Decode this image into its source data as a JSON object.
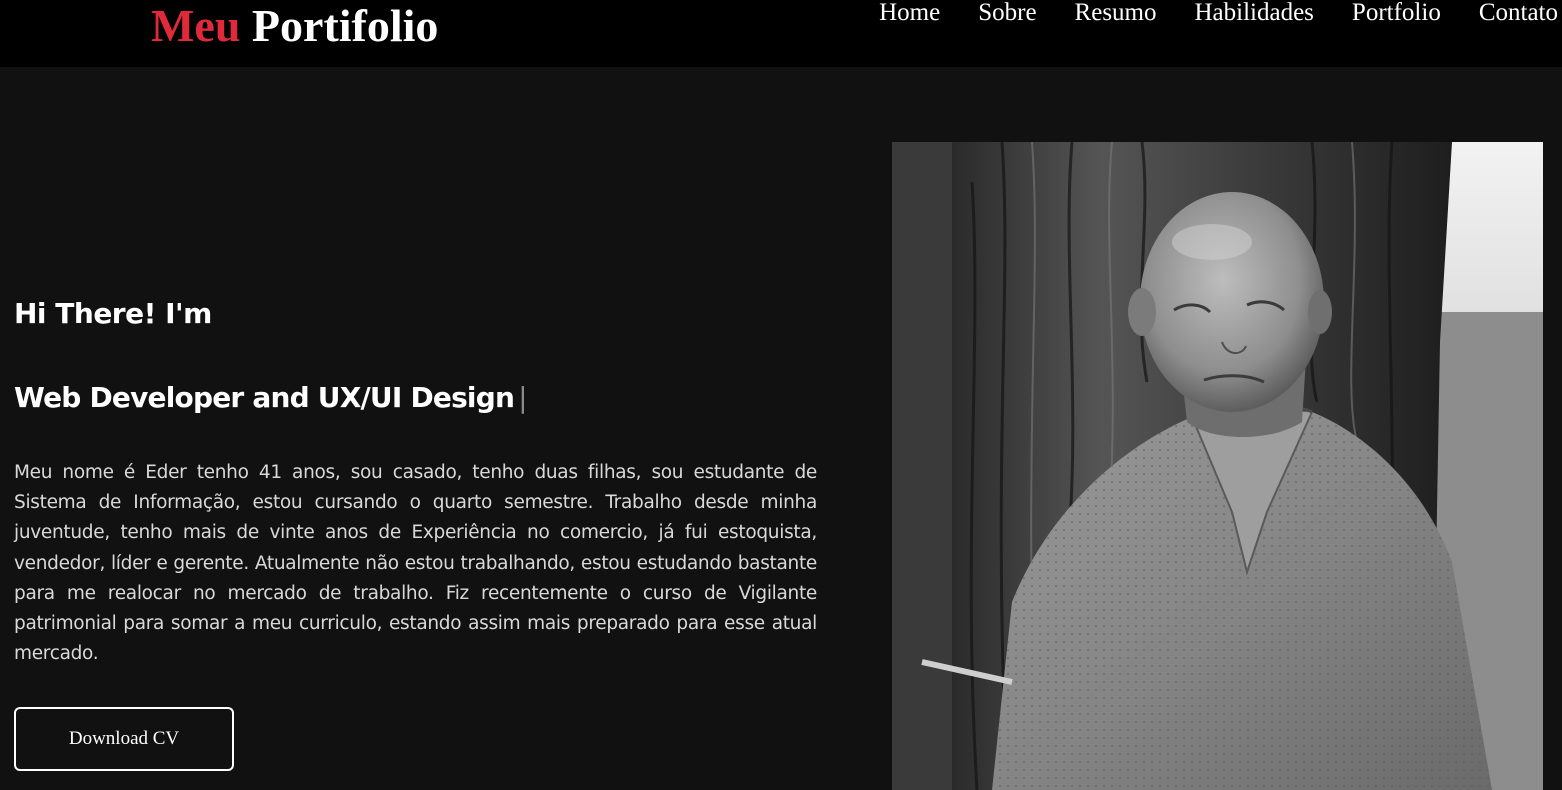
{
  "header": {
    "logo_accent": "Meu",
    "logo_main": "Portifolio",
    "nav": [
      {
        "label": "Home"
      },
      {
        "label": "Sobre"
      },
      {
        "label": "Resumo"
      },
      {
        "label": "Habilidades"
      },
      {
        "label": "Portfolio"
      },
      {
        "label": "Contato"
      }
    ]
  },
  "hero": {
    "greeting": "Hi There! I'm",
    "role": "Web Developer and UX/UI Design",
    "cursor": "|",
    "bio": "Meu nome é Eder tenho 41 anos, sou casado, tenho duas filhas, sou estudante de Sistema de Informação, estou cursando o quarto semestre. Trabalho desde minha juventude, tenho mais de vinte anos de Experiência no comercio, já fui estoquista, vendedor, líder e gerente. Atualmente não estou trabalhando, estou estudando bastante para me realocar no mercado de trabalho. Fiz recentemente o curso de Vigilante patrimonial para somar a meu curriculo, estando assim mais preparado para esse atual mercado.",
    "cv_button": "Download CV"
  },
  "colors": {
    "accent": "#e0293a",
    "background": "#111111",
    "header_bg": "#000000",
    "text": "#ffffff"
  }
}
